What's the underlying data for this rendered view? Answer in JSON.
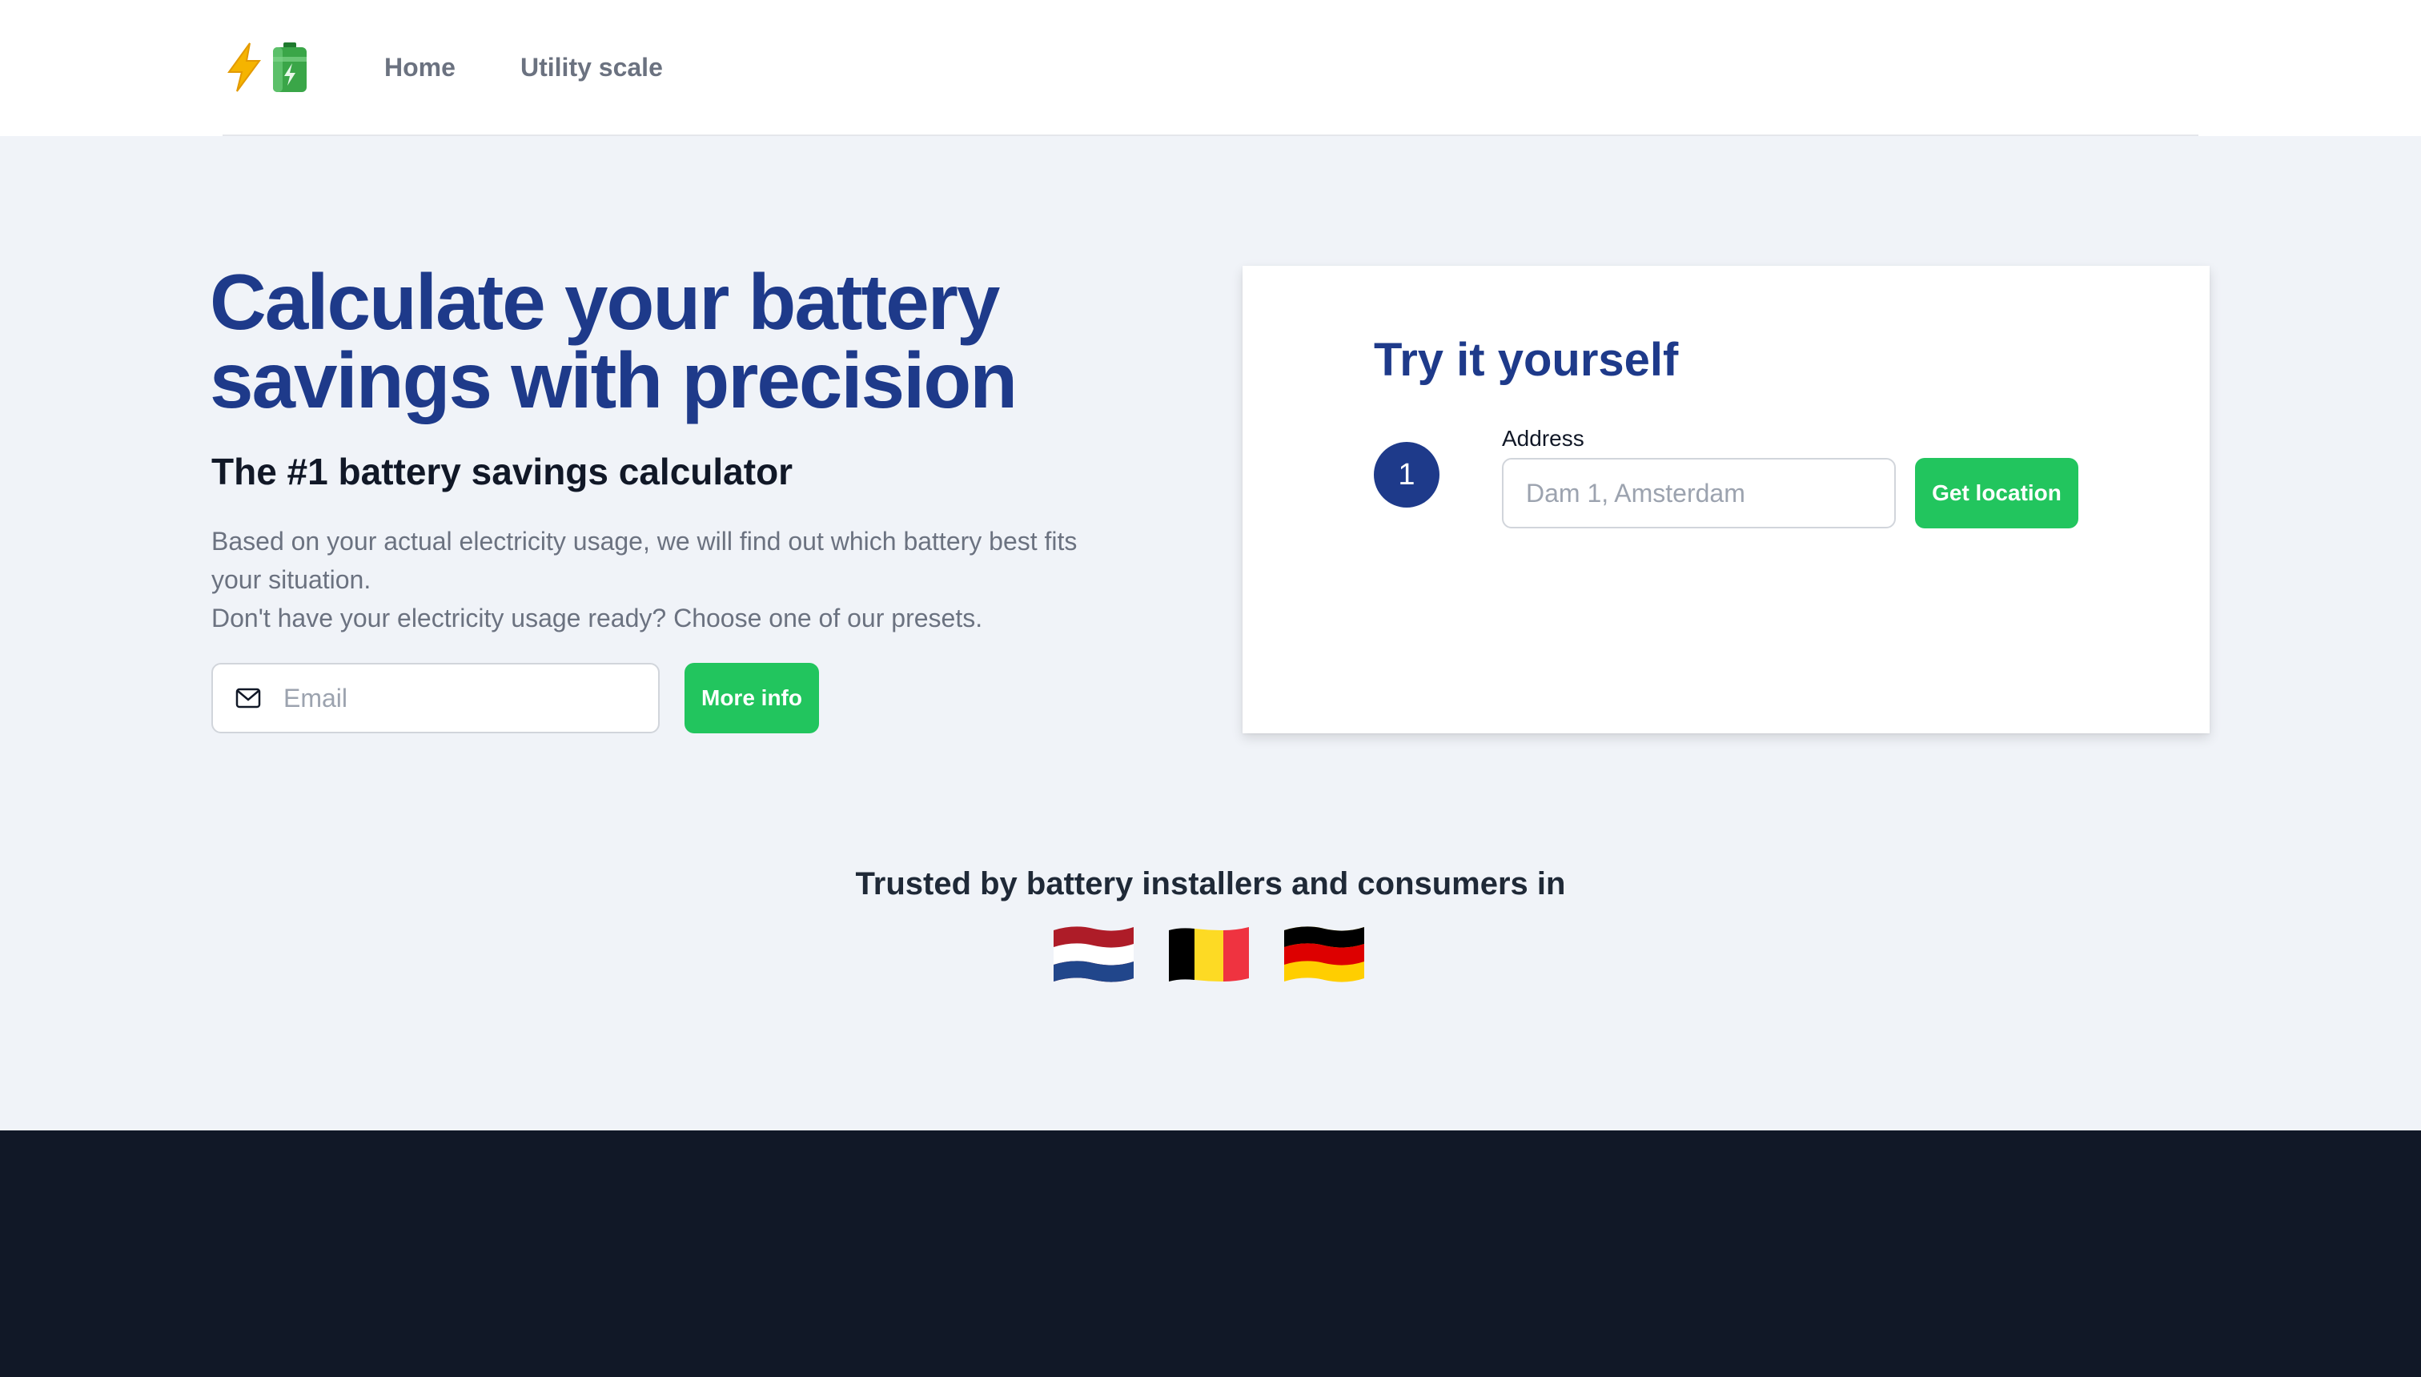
{
  "nav": {
    "logo_icons": [
      "lightning-icon",
      "battery-icon"
    ],
    "links": [
      {
        "label": "Home"
      },
      {
        "label": "Utility scale"
      }
    ]
  },
  "hero": {
    "title_line1": "Calculate your battery",
    "title_line2": "savings with precision",
    "subtitle": "The #1 battery savings calculator",
    "description_line1": "Based on your actual electricity usage, we will find out which battery best fits",
    "description_line2": "your situation.",
    "description_line3": "Don't have your electricity usage ready? Choose one of our presets.",
    "email_placeholder": "Email",
    "email_value": "",
    "more_info_label": "More info"
  },
  "calculator": {
    "title": "Try it yourself",
    "step_number": "1",
    "address_label": "Address",
    "address_placeholder": "Dam 1, Amsterdam",
    "address_value": "",
    "get_location_label": "Get location"
  },
  "trusted": {
    "heading": "Trusted by battery installers and consumers in",
    "flags": [
      "netherlands-flag-icon",
      "belgium-flag-icon",
      "germany-flag-icon"
    ]
  },
  "colors": {
    "brand_blue": "#1e3a8a",
    "accent_green": "#22c55e",
    "background": "#f0f3f8",
    "footer": "#111827"
  }
}
